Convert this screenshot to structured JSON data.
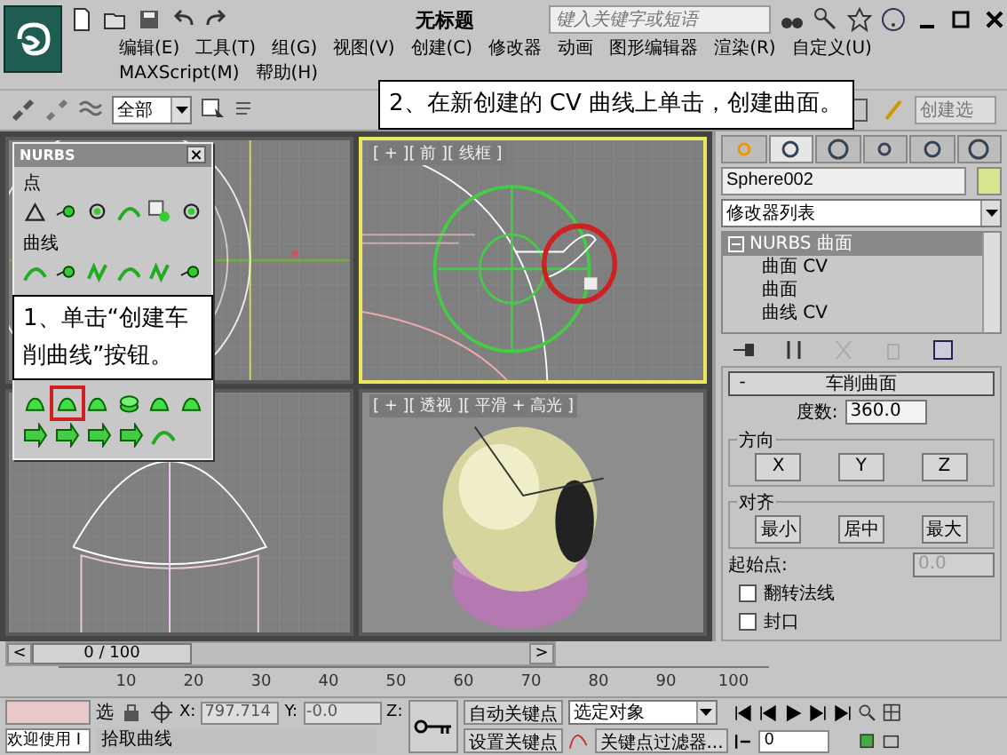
{
  "title_bar": {
    "title": "无标题",
    "search": {
      "placeholder": "键入关键字或短语"
    }
  },
  "menu": [
    "编辑(E)",
    "工具(T)",
    "组(G)",
    "视图(V)",
    "创建(C)",
    "修改器",
    "动画",
    "图形编辑器",
    "渲染(R)",
    "自定义(U)",
    "MAXScript(M)",
    "帮助(H)"
  ],
  "toolbar": {
    "selection_filter": "全部",
    "named_selection": "创建选"
  },
  "viewports": [
    {
      "kind": "top",
      "active": false
    },
    {
      "kind": "front",
      "label": "[ + ][ 前 ][ 线框 ]",
      "active": true
    },
    {
      "kind": "left",
      "active": false
    },
    {
      "kind": "perspective",
      "label": "[ + ][ 透视 ][ 平滑 + 高光 ]",
      "active": false
    }
  ],
  "nurbs_panel": {
    "title": "NURBS",
    "close": "×",
    "point_label": "点",
    "curve_label": "曲线"
  },
  "callouts": [
    "1、单击“创建车削曲线”按钮。",
    "2、在新创建的 CV 曲线上单击，创建曲面。"
  ],
  "command_panel": {
    "tabs": [
      {
        "selected": false
      },
      {
        "selected": true
      },
      {
        "selected": false
      },
      {
        "selected": false
      },
      {
        "selected": false
      },
      {
        "selected": false
      }
    ],
    "object_name": "Sphere002",
    "modifier_list": "修改器列表",
    "stack": [
      {
        "label": "NURBS 曲面",
        "selected": true,
        "expanded": true,
        "children": [
          {
            "label": "曲面 CV",
            "selected": false
          },
          {
            "label": "曲面",
            "selected": false
          },
          {
            "label": "曲线 CV",
            "selected": false
          }
        ]
      }
    ],
    "rollout": {
      "sign": "-",
      "title": "车削曲面",
      "degrees_label": "度数:",
      "degrees": "360.0",
      "direction": {
        "title": "方向",
        "buttons": [
          "X",
          "Y",
          "Z"
        ]
      },
      "align": {
        "title": "对齐",
        "buttons": [
          "最小",
          "居中",
          "最大"
        ]
      },
      "start_label": "起始点:",
      "start": "0.0",
      "start_disabled": true,
      "options": [
        {
          "label": "翻转法线",
          "checked": false
        },
        {
          "label": "封口",
          "checked": false
        }
      ]
    }
  },
  "timeline": {
    "slider": "0 / 100",
    "level": 0,
    "prev": "<",
    "next": ">",
    "ticks": [
      "10",
      "20",
      "30",
      "40",
      "50",
      "60",
      "70",
      "80",
      "90",
      "100"
    ]
  },
  "status": {
    "welcome": "欢迎使用 I",
    "lock_label": "选",
    "coords": [
      {
        "label": "X:",
        "value": "797.714"
      },
      {
        "label": "Y:",
        "value": "-0.0"
      },
      {
        "label": "Z:"
      }
    ],
    "prompt": "拾取曲线",
    "auto_key": "自动关键点",
    "set_key": "设置关键点",
    "key_mode": "选定对象",
    "key_filters": "关键点过滤器...",
    "frame": "0"
  }
}
